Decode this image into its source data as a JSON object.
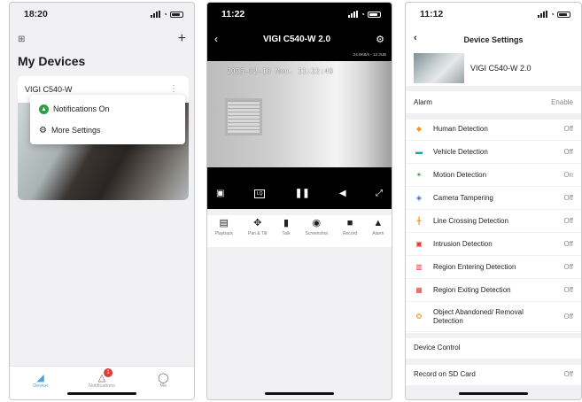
{
  "colors": {
    "accent": "#4aa6d8",
    "badge": "#e53935",
    "green": "#2e9e44",
    "orange": "#f29a1f",
    "teal": "#1aa0a0",
    "blue": "#3a6fd8",
    "red": "#e53935"
  },
  "phone1": {
    "time": "18:20",
    "title": "My Devices",
    "device_name": "VIGI C540-W",
    "menu": [
      {
        "label": "Notifications On",
        "icon": "bell-icon"
      },
      {
        "label": "More Settings",
        "icon": "gear-icon"
      }
    ],
    "tabs": [
      {
        "label": "Device",
        "icon": "camera-icon",
        "active": true
      },
      {
        "label": "Notifications",
        "icon": "bell-icon",
        "badge": "1"
      },
      {
        "label": "Me",
        "icon": "person-icon"
      }
    ]
  },
  "phone2": {
    "time": "11:22",
    "title": "VIGI C540-W 2.0",
    "bitrate": "24.0KB/s - 12.3UB",
    "osd": "2023-02-13 Mon. 11:22:49",
    "quality": "LQ",
    "tools": [
      {
        "label": "Playback",
        "icon": "playback-icon"
      },
      {
        "label": "Pan & Tilt",
        "icon": "pan-tilt-icon"
      },
      {
        "label": "Talk",
        "icon": "microphone-icon"
      },
      {
        "label": "Screenshot",
        "icon": "camera-icon"
      },
      {
        "label": "Record",
        "icon": "video-record-icon"
      },
      {
        "label": "Alarm",
        "icon": "alarm-icon"
      }
    ]
  },
  "phone3": {
    "time": "11:12",
    "title": "Device Settings",
    "device_name": "VIGI C540-W 2.0",
    "alarm": {
      "label": "Alarm",
      "value": "Enable"
    },
    "detections": [
      {
        "label": "Human Detection",
        "value": "Off",
        "icon": "person-icon"
      },
      {
        "label": "Vehicle Detection",
        "value": "Off",
        "icon": "car-icon"
      },
      {
        "label": "Motion Detection",
        "value": "On",
        "icon": "running-icon"
      },
      {
        "label": "Camera Tampering",
        "value": "Off",
        "icon": "tamper-icon"
      },
      {
        "label": "Line Crossing Detection",
        "value": "Off",
        "icon": "line-crossing-icon"
      },
      {
        "label": "Intrusion Detection",
        "value": "Off",
        "icon": "intrusion-icon"
      },
      {
        "label": "Region Entering Detection",
        "value": "Off",
        "icon": "region-enter-icon"
      },
      {
        "label": "Region Exiting Detection",
        "value": "Off",
        "icon": "region-exit-icon"
      },
      {
        "label": "Object Abandoned/ Removal Detection",
        "value": "Off",
        "icon": "object-icon"
      }
    ],
    "device_control": "Device Control",
    "record": {
      "label": "Record on SD Card",
      "value": "Off"
    }
  }
}
